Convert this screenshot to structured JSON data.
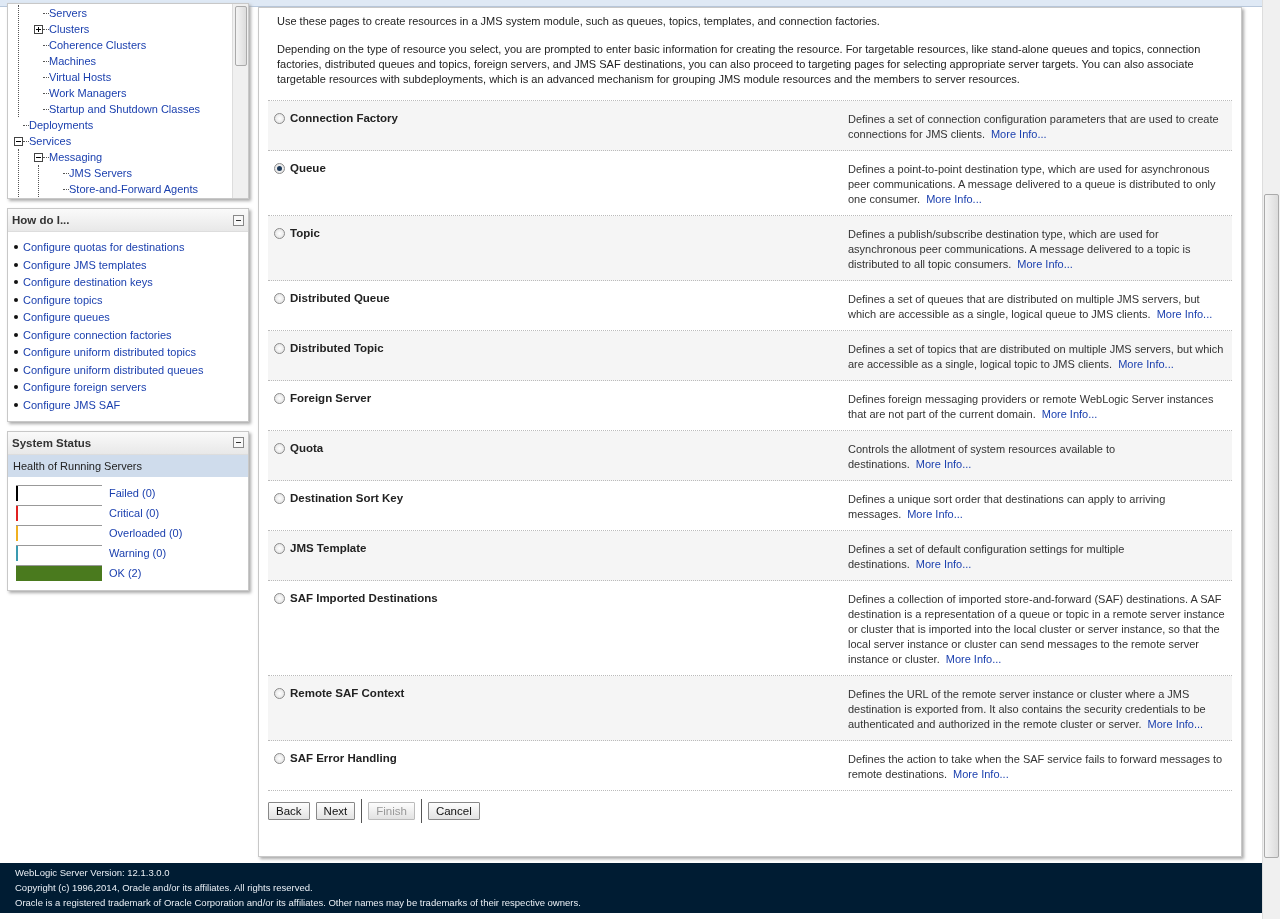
{
  "tree": {
    "items": [
      {
        "children": [
          {
            "label": "Servers"
          },
          {
            "label": "Clusters",
            "expanded": false
          },
          {
            "label": "Coherence Clusters"
          },
          {
            "label": "Machines"
          },
          {
            "label": "Virtual Hosts"
          },
          {
            "label": "Work Managers"
          },
          {
            "label": "Startup and Shutdown Classes"
          }
        ]
      },
      {
        "label": "Deployments"
      },
      {
        "label": "Services",
        "expanded": true,
        "children": [
          {
            "label": "Messaging",
            "expanded": true,
            "children": [
              {
                "label": "JMS Servers"
              },
              {
                "label": "Store-and-Forward Agents"
              }
            ]
          }
        ]
      }
    ]
  },
  "how_do_i": {
    "title": "How do I...",
    "links": [
      "Configure quotas for destinations",
      "Configure JMS templates",
      "Configure destination keys",
      "Configure topics",
      "Configure queues",
      "Configure connection factories",
      "Configure uniform distributed topics",
      "Configure uniform distributed queues",
      "Configure foreign servers",
      "Configure JMS SAF"
    ]
  },
  "system_status": {
    "title": "System Status",
    "subtitle": "Health of Running Servers",
    "items": [
      {
        "label": "Failed (0)",
        "color": "#000000",
        "level": 0
      },
      {
        "label": "Critical (0)",
        "color": "#e02020",
        "level": 0
      },
      {
        "label": "Overloaded (0)",
        "color": "#f0b020",
        "level": 0
      },
      {
        "label": "Warning (0)",
        "color": "#3a9ab0",
        "level": 0
      },
      {
        "label": "OK (2)",
        "color": "#4a7a1e",
        "level": 1
      }
    ]
  },
  "intro": [
    "Use these pages to create resources in a JMS system module, such as queues, topics, templates, and connection factories.",
    "Depending on the type of resource you select, you are prompted to enter basic information for creating the resource. For targetable resources, like stand-alone queues and topics, connection factories, distributed queues and topics, foreign servers, and JMS SAF destinations, you can also proceed to targeting pages for selecting appropriate server targets. You can also associate targetable resources with subdeployments, which is an advanced mechanism for grouping JMS module resources and the members to server resources."
  ],
  "options": [
    {
      "label": "Connection Factory",
      "selected": false,
      "description": "Defines a set of connection configuration parameters that are used to create connections for JMS clients.",
      "link": "More Info..."
    },
    {
      "label": "Queue",
      "selected": true,
      "description": "Defines a point-to-point destination type, which are used for asynchronous peer communications. A message delivered to a queue is distributed to only one consumer.",
      "link": "More Info..."
    },
    {
      "label": "Topic",
      "selected": false,
      "description": "Defines a publish/subscribe destination type, which are used for asynchronous peer communications. A message delivered to a topic is distributed to all topic consumers.",
      "link": "More Info..."
    },
    {
      "label": "Distributed Queue",
      "selected": false,
      "description": "Defines a set of queues that are distributed on multiple JMS servers, but which are accessible as a single, logical queue to JMS clients.",
      "link": "More Info..."
    },
    {
      "label": "Distributed Topic",
      "selected": false,
      "description": "Defines a set of topics that are distributed on multiple JMS servers, but which are accessible as a single, logical topic to JMS clients.",
      "link": "More Info..."
    },
    {
      "label": "Foreign Server",
      "selected": false,
      "description": "Defines foreign messaging providers or remote WebLogic Server instances that are not part of the current domain.",
      "link": "More Info..."
    },
    {
      "label": "Quota",
      "selected": false,
      "description": "Controls the allotment of system resources available to destinations.",
      "link": "More Info..."
    },
    {
      "label": "Destination Sort Key",
      "selected": false,
      "description": "Defines a unique sort order that destinations can apply to arriving messages.",
      "link": "More Info..."
    },
    {
      "label": "JMS Template",
      "selected": false,
      "description": "Defines a set of default configuration settings for multiple destinations.",
      "link": "More Info..."
    },
    {
      "label": "SAF Imported Destinations",
      "selected": false,
      "description": "Defines a collection of imported store-and-forward (SAF) destinations. A SAF destination is a representation of a queue or topic in a remote server instance or cluster that is imported into the local cluster or server instance, so that the local server instance or cluster can send messages to the remote server instance or cluster.",
      "link": "More Info..."
    },
    {
      "label": "Remote SAF Context",
      "selected": false,
      "description": "Defines the URL of the remote server instance or cluster where a JMS destination is exported from. It also contains the security credentials to be authenticated and authorized in the remote cluster or server.",
      "link": "More Info..."
    },
    {
      "label": "SAF Error Handling",
      "selected": false,
      "description": "Defines the action to take when the SAF service fails to forward messages to remote destinations.",
      "link": "More Info..."
    }
  ],
  "buttons": [
    {
      "label": "Back",
      "disabled": false
    },
    {
      "label": "Next",
      "disabled": false
    },
    {
      "label": "Finish",
      "disabled": true
    },
    {
      "label": "Cancel",
      "disabled": false
    }
  ],
  "footer": [
    "WebLogic Server Version: 12.1.3.0.0",
    "Copyright (c) 1996,2014, Oracle and/or its affiliates. All rights reserved.",
    "Oracle is a registered trademark of Oracle Corporation and/or its affiliates. Other names may be trademarks of their respective owners."
  ]
}
